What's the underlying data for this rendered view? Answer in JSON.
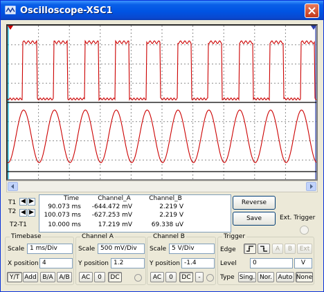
{
  "window": {
    "title": "Oscilloscope-XSC1"
  },
  "measurements": {
    "t1_label": "T1",
    "t2_label": "T2",
    "diff_label": "T2-T1",
    "headers": {
      "time": "Time",
      "a": "Channel_A",
      "b": "Channel_B"
    },
    "rows": [
      {
        "time": "90.073 ms",
        "a": "-644.472 mV",
        "b": "2.219 V"
      },
      {
        "time": "100.073 ms",
        "a": "-627.253 mV",
        "b": "2.219 V"
      },
      {
        "time": "10.000 ms",
        "a": "17.219 mV",
        "b": "69.338 uV"
      }
    ]
  },
  "buttons": {
    "reverse": "Reverse",
    "save": "Save",
    "ext_trigger": "Ext. Trigger"
  },
  "timebase": {
    "title": "Timebase",
    "scale_label": "Scale",
    "scale_value": "1 ms/Div",
    "xpos_label": "X position",
    "xpos_value": "4",
    "modes": [
      "Y/T",
      "Add",
      "B/A",
      "A/B"
    ]
  },
  "channel_a": {
    "title": "Channel A",
    "scale_label": "Scale",
    "scale_value": "500 mV/Div",
    "ypos_label": "Y position",
    "ypos_value": "1.2",
    "coupling": [
      "AC",
      "0",
      "DC"
    ]
  },
  "channel_b": {
    "title": "Channel B",
    "scale_label": "Scale",
    "scale_value": "5  V/Div",
    "ypos_label": "Y position",
    "ypos_value": "-1.4",
    "coupling": [
      "AC",
      "0",
      "DC",
      "-"
    ]
  },
  "trigger": {
    "title": "Trigger",
    "edge_label": "Edge",
    "sources": [
      "A",
      "B",
      "Ext"
    ],
    "level_label": "Level",
    "level_value": "0",
    "level_unit": "V",
    "type_label": "Type",
    "types": [
      "Sing.",
      "Nor.",
      "Auto",
      "None"
    ]
  },
  "trace_colors": {
    "channel_a": "#cc0000",
    "channel_b": "#000000"
  }
}
